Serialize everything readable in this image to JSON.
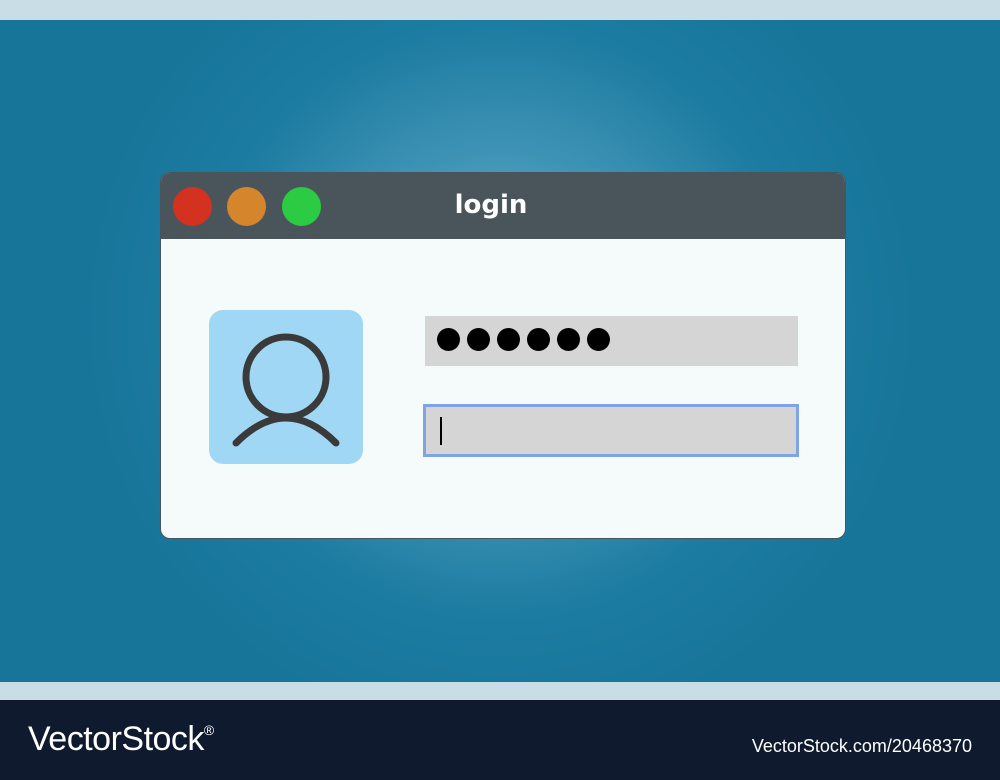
{
  "window": {
    "title": "login",
    "controls": {
      "close_color": "#d2321f",
      "minimize_color": "#d5862d",
      "maximize_color": "#2bcc43"
    }
  },
  "avatar": {
    "icon": "user-icon",
    "background_color": "#9fd7f5"
  },
  "fields": {
    "password": {
      "masked_char_count": 6,
      "value": "●●●●●●"
    },
    "username": {
      "value": "",
      "focused": true
    }
  },
  "footer": {
    "brand": "VectorStock",
    "registered_mark": "®",
    "image_id": "VectorStock.com/20468370"
  }
}
